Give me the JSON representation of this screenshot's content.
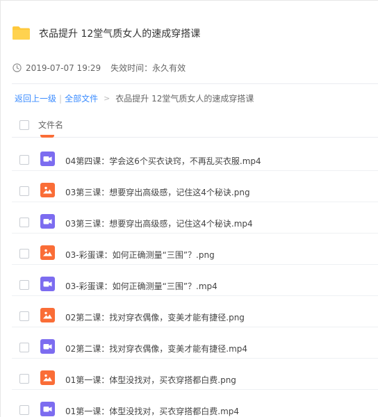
{
  "share": {
    "title": "衣品提升 12堂气质女人的速成穿搭课",
    "date": "2019-07-07 19:29",
    "expire": "失效时间：永久有效"
  },
  "breadcrumb": {
    "back": "返回上一级",
    "separator": "|",
    "all_files": "全部文件",
    "arrow": ">",
    "current": "衣品提升 12堂气质女人的速成穿搭课"
  },
  "table": {
    "column_header": "文件名"
  },
  "colors": {
    "video_icon": "#7c6cf0",
    "image_icon": "#fa6d37",
    "link": "#3b8cff",
    "folder": "#ffc93c"
  },
  "files": [
    {
      "name": "04第四课：学会这6个买衣诀窍，不再乱买衣服.mp4",
      "type": "video",
      "icon": "video-file-icon"
    },
    {
      "name": "03第三课：想要穿出高级感，记住这4个秘诀.png",
      "type": "image",
      "icon": "image-file-icon"
    },
    {
      "name": "03第三课：想要穿出高级感，记住这4个秘诀.mp4",
      "type": "video",
      "icon": "video-file-icon"
    },
    {
      "name": "03-彩蛋课：如何正确测量“三围”？.png",
      "type": "image",
      "icon": "image-file-icon"
    },
    {
      "name": "03-彩蛋课：如何正确测量“三围”？.mp4",
      "type": "video",
      "icon": "video-file-icon"
    },
    {
      "name": "02第二课：找对穿衣偶像，变美才能有捷径.png",
      "type": "image",
      "icon": "image-file-icon"
    },
    {
      "name": "02第二课：找对穿衣偶像，变美才能有捷径.mp4",
      "type": "video",
      "icon": "video-file-icon"
    },
    {
      "name": "01第一课：体型没找对，买衣穿搭都白费.png",
      "type": "image",
      "icon": "image-file-icon"
    },
    {
      "name": "01第一课：体型没找对，买衣穿搭都白费.mp4",
      "type": "video",
      "icon": "video-file-icon"
    }
  ]
}
